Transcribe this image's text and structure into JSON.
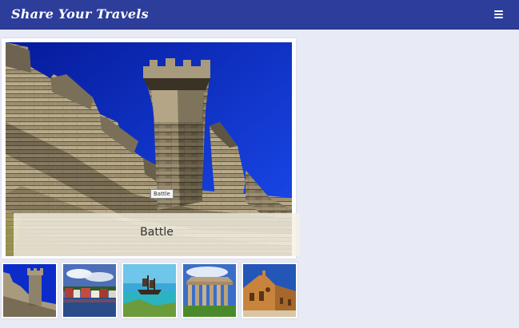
{
  "header": {
    "title": "Share Your Travels",
    "menu_icon": "hamburger-menu-icon"
  },
  "main_image": {
    "tooltip": "Battle",
    "caption": "Battle"
  },
  "thumbnails": [
    {
      "subject": "castle-battlements"
    },
    {
      "subject": "harbour-town"
    },
    {
      "subject": "pirate-ship-lagoon"
    },
    {
      "subject": "greek-temple"
    },
    {
      "subject": "cathedral"
    }
  ],
  "colors": {
    "header_bg": "#2d3d9a",
    "page_bg": "#e8ebf6",
    "sky": "#0a2bd8",
    "stone": "#a09378"
  }
}
